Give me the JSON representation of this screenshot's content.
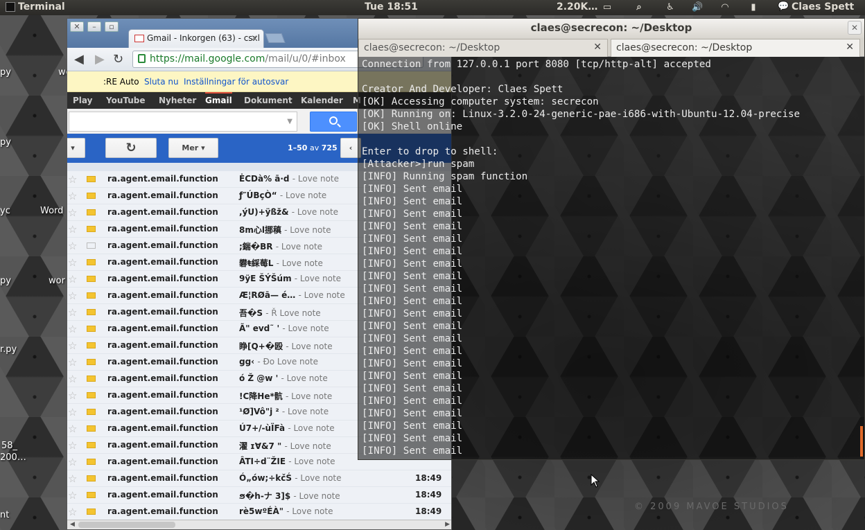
{
  "top_panel": {
    "app_name": "Terminal",
    "clock": "Tue 18:51",
    "network_speed": "2.20K…",
    "user_name": "Claes Spett",
    "icons": [
      "network-monitor-icon",
      "search-icon",
      "accessibility-icon",
      "volume-icon",
      "wifi-icon",
      "battery-icon",
      "chat-icon"
    ]
  },
  "desktop": {
    "labels": [
      "py",
      "wo",
      "py",
      "yc",
      "Word",
      "py",
      "wor",
      "r.py",
      "58_",
      "200…",
      "nt"
    ],
    "watermark": "© 2009 MAVOE STUDIOS"
  },
  "browser": {
    "tab_title": "Gmail - Inkorgen (63) - csxl",
    "url_secure": "https://mail.google.com",
    "url_rest": "/mail/u/0/#inbox",
    "autosave": {
      "prefix": ":RE Auto",
      "stop_link": "Sluta nu",
      "settings_link": "Inställningar för autosvar"
    },
    "gbar": [
      "Play",
      "YouTube",
      "Nyheter",
      "Gmail",
      "Dokument",
      "Kalender",
      "M"
    ],
    "more_button": "Mer",
    "pagination_range": "1–50",
    "pagination_of": "av",
    "pagination_total": "725",
    "rows": [
      {
        "from": "ra.agent.email.function",
        "subject": "ĖCDà% ā·d",
        "snippet": "- Love note",
        "time": "",
        "label": "yellow"
      },
      {
        "from": "ra.agent.email.function",
        "subject": "ƒ″ÚBçÒ“",
        "snippet": "- Love note",
        "time": "",
        "label": "yellow"
      },
      {
        "from": "ra.agent.email.function",
        "subject": ",ýU)+ÿßž&",
        "snippet": "- Love note",
        "time": "",
        "label": "yellow"
      },
      {
        "from": "ra.agent.email.function",
        "subject": "8m心l挪稹",
        "snippet": "- Love note",
        "time": "",
        "label": "yellow"
      },
      {
        "from": "ra.agent.email.function",
        "subject": ";鍴�BR",
        "snippet": "- Love note",
        "time": "",
        "label": "empty"
      },
      {
        "from": "ra.agent.email.function",
        "subject": "礬ŧ綵莓L",
        "snippet": "- Love note",
        "time": "",
        "label": "yellow"
      },
      {
        "from": "ra.agent.email.function",
        "subject": "9ÿE ŠÝŠúm",
        "snippet": "- Love note",
        "time": "",
        "label": "yellow"
      },
      {
        "from": "ra.agent.email.function",
        "subject": "Æ¦RØā— é…",
        "snippet": "- Love note",
        "time": "",
        "label": "yellow"
      },
      {
        "from": "ra.agent.email.function",
        "subject": "吾�S",
        "snippet": "- Ř Love note",
        "time": "",
        "label": "yellow"
      },
      {
        "from": "ra.agent.email.function",
        "subject": "Ã\" evd˜ '",
        "snippet": "- Love note",
        "time": "",
        "label": "yellow"
      },
      {
        "from": "ra.agent.email.function",
        "subject": "睁[Q+�殴",
        "snippet": "- Love note",
        "time": "",
        "label": "yellow"
      },
      {
        "from": "ra.agent.email.function",
        "subject": "gg‹",
        "snippet": "- Ðo Love note",
        "time": "",
        "label": "yellow"
      },
      {
        "from": "ra.agent.email.function",
        "subject": "ó Ž @w '",
        "snippet": "- Love note",
        "time": "",
        "label": "yellow"
      },
      {
        "from": "ra.agent.email.function",
        "subject": "!C降He*骯",
        "snippet": "- Love note",
        "time": "",
        "label": "yellow"
      },
      {
        "from": "ra.agent.email.function",
        "subject": "¹Ø]Vô\"j ²",
        "snippet": "- Love note",
        "time": "",
        "label": "yellow"
      },
      {
        "from": "ra.agent.email.function",
        "subject": "Ú7+/-ùÏFà",
        "snippet": "- Love note",
        "time": "",
        "label": "yellow"
      },
      {
        "from": "ra.agent.email.function",
        "subject": "濯 ɪⱯ&7 \"",
        "snippet": "- Love note",
        "time": "",
        "label": "yellow"
      },
      {
        "from": "ra.agent.email.function",
        "subject": "ÂTI÷d¨ŽIE",
        "snippet": "- Love note",
        "time": "",
        "label": "yellow"
      },
      {
        "from": "ra.agent.email.function",
        "subject": "Ó„ów;÷kčŚ",
        "snippet": "- Love note",
        "time": "18:49",
        "label": "yellow"
      },
      {
        "from": "ra.agent.email.function",
        "subject": "ϧ�h-ナ 3]$",
        "snippet": "- Love note",
        "time": "18:49",
        "label": "yellow"
      },
      {
        "from": "ra.agent.email.function",
        "subject": "rè5wºÉÀ\"",
        "snippet": "- Love note",
        "time": "18:49",
        "label": "yellow"
      }
    ]
  },
  "terminal": {
    "title": "claes@secrecon: ~/Desktop",
    "tabs": [
      "claes@secrecon: ~/Desktop",
      "claes@secrecon: ~/Desktop"
    ],
    "output": "Connection from 127.0.0.1 port 8080 [tcp/http-alt] accepted\n\nCreator And Developer: Claes Spett\n[OK] Accessing computer system: secrecon\n[OK] Running on: Linux-3.2.0-24-generic-pae-i686-with-Ubuntu-12.04-precise\n[OK] Shell online\n\nEnter to drop to shell:\n[Attacker>]run spam\n[INFO] Running spam function\n[INFO] Sent email\n[INFO] Sent email\n[INFO] Sent email\n[INFO] Sent email\n[INFO] Sent email\n[INFO] Sent email\n[INFO] Sent email\n[INFO] Sent email\n[INFO] Sent email\n[INFO] Sent email\n[INFO] Sent email\n[INFO] Sent email\n[INFO] Sent email\n[INFO] Sent email\n[INFO] Sent email\n[INFO] Sent email\n[INFO] Sent email\n[INFO] Sent email\n[INFO] Sent email\n[INFO] Sent email\n[INFO] Sent email\n[INFO] Sent email"
  }
}
